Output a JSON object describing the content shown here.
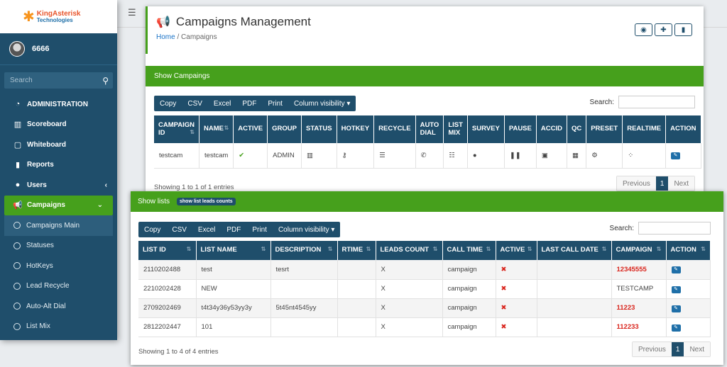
{
  "brand": {
    "name": "KingAsterisk",
    "sub": "Technologies"
  },
  "user": {
    "name": "6666"
  },
  "search": {
    "placeholder": "Search"
  },
  "menu": [
    {
      "label": "ADMINISTRATION",
      "icon": "dashboard-icon"
    },
    {
      "label": "Scoreboard",
      "icon": "bar-chart-icon"
    },
    {
      "label": "Whiteboard",
      "icon": "square-icon"
    },
    {
      "label": "Reports",
      "icon": "file-icon"
    },
    {
      "label": "Users",
      "icon": "user-icon"
    },
    {
      "label": "Campaigns",
      "icon": "megaphone-icon"
    }
  ],
  "submenu": [
    "Campaigns Main",
    "Statuses",
    "HotKeys",
    "Lead Recycle",
    "Auto-Alt Dial",
    "List Mix"
  ],
  "page": {
    "title": "Campaigns Management",
    "crumb_home": "Home",
    "crumb_sep": "/",
    "crumb_current": "Campaigns"
  },
  "campaigns_panel": {
    "heading": "Show Campaings",
    "buttons": [
      "Copy",
      "CSV",
      "Excel",
      "PDF",
      "Print",
      "Column visibility ▾"
    ],
    "search_label": "Search:",
    "columns": [
      "CAMPAIGN ID",
      "NAME",
      "ACTIVE",
      "GROUP",
      "STATUS",
      "HOTKEY",
      "RECYCLE",
      "AUTO DIAL",
      "LIST MIX",
      "SURVEY",
      "PAUSE",
      "ACCID",
      "QC",
      "PRESET",
      "REALTIME",
      "ACTION"
    ],
    "row": {
      "id": "testcam",
      "name": "testcam",
      "group": "ADMIN"
    },
    "showing": "Showing 1 to 1 of 1 entries",
    "pager": {
      "prev": "Previous",
      "page": "1",
      "next": "Next"
    }
  },
  "lists_panel": {
    "heading": "Show lists",
    "badge": "show list leads counts",
    "buttons": [
      "Copy",
      "CSV",
      "Excel",
      "PDF",
      "Print",
      "Column visibility ▾"
    ],
    "search_label": "Search:",
    "columns": [
      "LIST ID",
      "LIST NAME",
      "DESCRIPTION",
      "RTIME",
      "LEADS COUNT",
      "CALL TIME",
      "ACTIVE",
      "LAST CALL DATE",
      "CAMPAIGN",
      "ACTION"
    ],
    "rows": [
      {
        "list_id": "2110202488",
        "list_name": "test",
        "description": "tesrt",
        "rtime": "",
        "leads_count": "X",
        "call_time": "campaign",
        "last_call_date": "",
        "campaign": "12345555",
        "campaign_red": true
      },
      {
        "list_id": "2210202428",
        "list_name": "NEW",
        "description": "",
        "rtime": "",
        "leads_count": "X",
        "call_time": "campaign",
        "last_call_date": "",
        "campaign": "TESTCAMP",
        "campaign_red": false
      },
      {
        "list_id": "2709202469",
        "list_name": "t4t34y36y53yy3y",
        "description": "5t45nt4545yy",
        "rtime": "",
        "leads_count": "X",
        "call_time": "campaign",
        "last_call_date": "",
        "campaign": "11223",
        "campaign_red": true
      },
      {
        "list_id": "2812202447",
        "list_name": "101",
        "description": "",
        "rtime": "",
        "leads_count": "X",
        "call_time": "campaign",
        "last_call_date": "",
        "campaign": "112233",
        "campaign_red": true
      }
    ],
    "showing": "Showing 1 to 4 of 4 entries",
    "pager": {
      "prev": "Previous",
      "page": "1",
      "next": "Next"
    }
  },
  "colors": {
    "sidebar": "#1f4e6b",
    "accent": "#46a01c",
    "danger": "#d9251d"
  }
}
